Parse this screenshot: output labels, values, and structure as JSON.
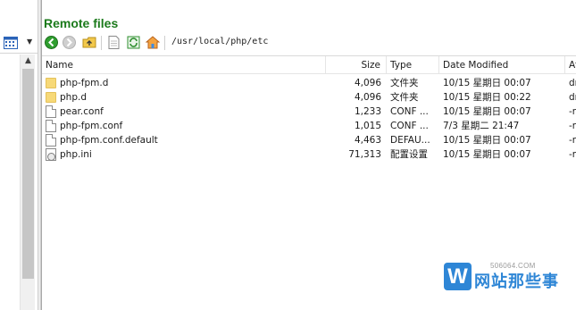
{
  "remote_panel": {
    "title": "Remote files",
    "path": "/usr/local/php/etc"
  },
  "columns": {
    "name": "Name",
    "size": "Size",
    "type": "Type",
    "date": "Date Modified",
    "attr": "At"
  },
  "files": [
    {
      "name": "php-fpm.d",
      "size": "4,096",
      "type": "文件夹",
      "date": "10/15 星期日 00:07",
      "attr": "dr",
      "icon": "folder-icon"
    },
    {
      "name": "php.d",
      "size": "4,096",
      "type": "文件夹",
      "date": "10/15 星期日 00:22",
      "attr": "dr",
      "icon": "folder-icon"
    },
    {
      "name": "pear.conf",
      "size": "1,233",
      "type": "CONF ...",
      "date": "10/15 星期日 00:07",
      "attr": "-r",
      "icon": "file-icon"
    },
    {
      "name": "php-fpm.conf",
      "size": "1,015",
      "type": "CONF ...",
      "date": "7/3 星期二 21:47",
      "attr": "-r",
      "icon": "file-icon"
    },
    {
      "name": "php-fpm.conf.default",
      "size": "4,463",
      "type": "DEFAU...",
      "date": "10/15 星期日 00:07",
      "attr": "-r",
      "icon": "file-icon"
    },
    {
      "name": "php.ini",
      "size": "71,313",
      "type": "配置设置",
      "date": "10/15 星期日 00:07",
      "attr": "-r",
      "icon": "settings-file-icon"
    }
  ],
  "watermark": {
    "url": "506064.COM",
    "logo_letter": "W",
    "text": "网站那些事"
  },
  "colors": {
    "title_green": "#1b7a1b",
    "folder_yellow": "#f7d978",
    "watermark_blue": "#2e86d6"
  }
}
